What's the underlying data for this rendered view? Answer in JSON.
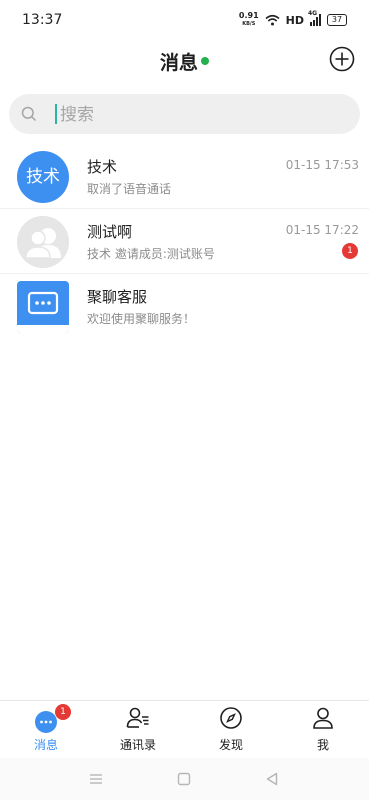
{
  "status_bar": {
    "time": "13:37",
    "net_speed_value": "0.91",
    "net_speed_unit": "KB/S",
    "hd_label": "HD",
    "signal_label": "4G",
    "battery": "37"
  },
  "header": {
    "title": "消息",
    "online_color": "#22b14c",
    "add_icon": "plus-circle-icon"
  },
  "search": {
    "placeholder": "搜索",
    "value": "",
    "icon": "search-icon"
  },
  "conversations": [
    {
      "name": "技术",
      "avatar_text": "技术",
      "last_message": "取消了语音通话",
      "time": "01-15 17:53",
      "unread": ""
    },
    {
      "name": "测试啊",
      "avatar_text": "",
      "last_message": "技术 邀请成员:测试账号",
      "time": "01-15 17:22",
      "unread": "1"
    },
    {
      "name": "聚聊客服",
      "avatar_text": "",
      "last_message": "欢迎使用聚聊服务！",
      "time": "",
      "unread": ""
    }
  ],
  "tabbar": {
    "tabs": [
      {
        "label": "消息",
        "icon": "chat-bubble-icon",
        "badge": "1",
        "active": true
      },
      {
        "label": "通讯录",
        "icon": "contacts-icon",
        "active": false
      },
      {
        "label": "发现",
        "icon": "compass-icon",
        "active": false
      },
      {
        "label": "我",
        "icon": "person-icon",
        "active": false
      }
    ]
  },
  "colors": {
    "accent": "#3d8ff0",
    "badge": "#e53935"
  }
}
